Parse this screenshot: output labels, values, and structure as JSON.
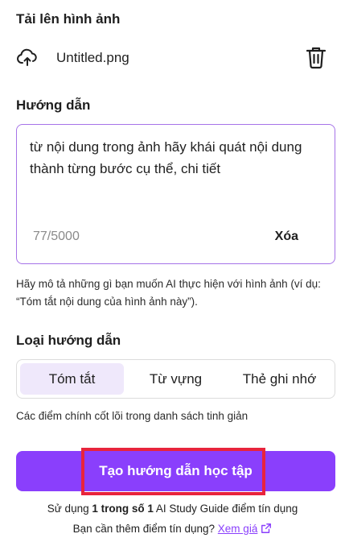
{
  "upload": {
    "title": "Tải lên hình ảnh",
    "file_name": "Untitled.png",
    "upload_icon": "cloud-upload-icon",
    "delete_icon": "trash-icon"
  },
  "instructions": {
    "title": "Hướng dẫn",
    "text": "từ nội dung trong ảnh hãy khái quát nội dung thành từng bước cụ thể, chi tiết",
    "counter": "77/5000",
    "clear_label": "Xóa",
    "hint": "Hãy mô tả những gì bạn muốn AI thực hiện với hình ảnh (ví dụ: “Tóm tắt nội dung của hình ảnh này”)."
  },
  "guide_type": {
    "title": "Loại hướng dẫn",
    "tabs": [
      {
        "label": "Tóm tắt",
        "active": true
      },
      {
        "label": "Từ vựng",
        "active": false
      },
      {
        "label": "Thẻ ghi nhớ",
        "active": false
      }
    ],
    "description": "Các điểm chính cốt lõi trong danh sách tinh giản"
  },
  "cta": {
    "label": "Tạo hướng dẫn học tập"
  },
  "usage": {
    "prefix": "Sử dụng ",
    "count": "1 trong số 1",
    "suffix": " AI Study Guide điểm tín dụng",
    "more_text": "Bạn cần thêm điểm tín dụng? ",
    "link_label": "Xem giá",
    "link_icon": "external-link-icon"
  },
  "colors": {
    "accent": "#8a3ffc",
    "textarea_border": "#a673e8",
    "active_tab": "#efe8fb",
    "highlight": "#e8243c"
  }
}
